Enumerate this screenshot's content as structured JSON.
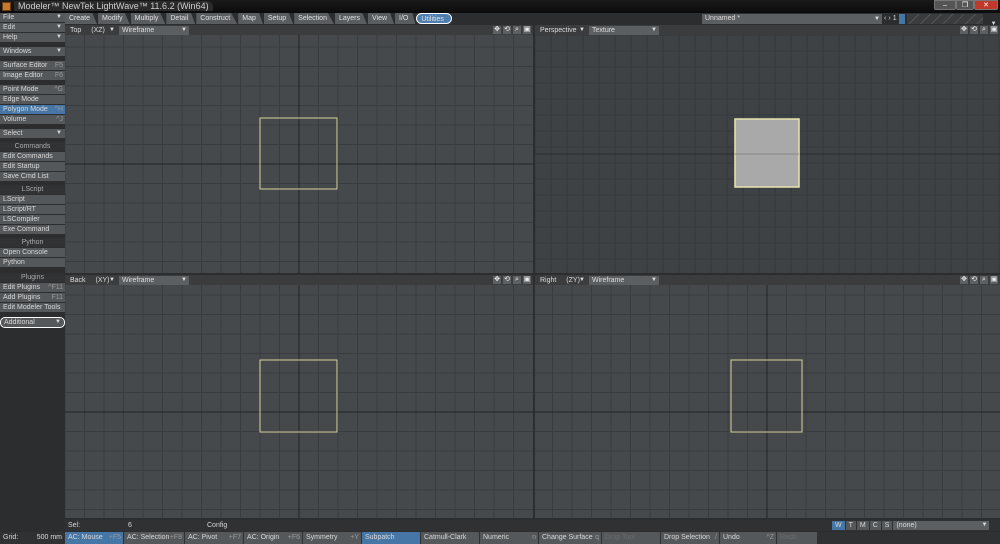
{
  "window": {
    "title": "Modeler™ NewTek LightWave™ 11.6.2 (Win64)",
    "minimize": "–",
    "maximize": "❐",
    "close": "✕"
  },
  "tabs": [
    "Create",
    "Modify",
    "Multiply",
    "Detail",
    "Construct",
    "Map",
    "Setup",
    "Selection",
    "Layers",
    "View",
    "I/O",
    "Utilities"
  ],
  "object_select": "Unnamed *",
  "layer_number": "1",
  "sidebar": {
    "menus": [
      {
        "label": "File"
      },
      {
        "label": "Edit"
      },
      {
        "label": "Help"
      }
    ],
    "windows": "Windows",
    "editors": [
      {
        "label": "Surface Editor",
        "key": "F5"
      },
      {
        "label": "Image Editor",
        "key": "F6"
      }
    ],
    "modes": [
      {
        "label": "Point Mode",
        "key": "^G"
      },
      {
        "label": "Edge Mode",
        "key": ""
      },
      {
        "label": "Polygon Mode",
        "key": "^H"
      },
      {
        "label": "Volume",
        "key": "^J"
      }
    ],
    "select": "Select",
    "commands_header": "Commands",
    "commands": [
      "Edit Commands",
      "Edit Startup",
      "Save Cmd List"
    ],
    "lscript_header": "LScript",
    "lscript": [
      "LScript",
      "LScript/RT",
      "LSCompiler",
      "Exe Command"
    ],
    "python_header": "Python",
    "python": [
      "Open Console",
      "Python"
    ],
    "plugins_header": "Plugins",
    "plugins": [
      {
        "label": "Edit Plugins",
        "key": "^F11"
      },
      {
        "label": "Add Plugins",
        "key": "F11"
      },
      {
        "label": "Edit Modeler Tools",
        "key": ""
      }
    ],
    "additional": "Additional"
  },
  "viewports": [
    {
      "view": "Top",
      "axis": "(XZ)",
      "mode": "Wireframe"
    },
    {
      "view": "Perspective",
      "axis": "",
      "mode": "Texture"
    },
    {
      "view": "Back",
      "axis": "(XY)",
      "mode": "Wireframe"
    },
    {
      "view": "Right",
      "axis": "(ZY)",
      "mode": "Wireframe"
    }
  ],
  "status": {
    "sel_label": "Sel:",
    "sel_value": "6",
    "config": "Config",
    "wtmcs": [
      "W",
      "T",
      "M",
      "C",
      "S"
    ],
    "surface": "(none)"
  },
  "bottom": {
    "grid_label": "Grid:",
    "grid_value": "500 mm",
    "buttons": [
      {
        "label": "AC: Mouse",
        "key": "+F5"
      },
      {
        "label": "AC: Selection",
        "key": "+F8"
      },
      {
        "label": "AC: Pivot",
        "key": "+F7"
      },
      {
        "label": "AC: Origin",
        "key": "+F6"
      },
      {
        "label": "Symmetry",
        "key": "+Y"
      },
      {
        "label": "Subpatch",
        "key": ""
      },
      {
        "label": "Catmull-Clark",
        "key": ""
      },
      {
        "label": "Numeric",
        "key": "n"
      },
      {
        "label": "Change Surface",
        "key": "q"
      },
      {
        "label": "Drop Tool",
        "key": ""
      },
      {
        "label": "Drop Selection",
        "key": "/"
      },
      {
        "label": "Undo",
        "key": "^Z"
      },
      {
        "label": "Redo",
        "key": ""
      }
    ]
  }
}
